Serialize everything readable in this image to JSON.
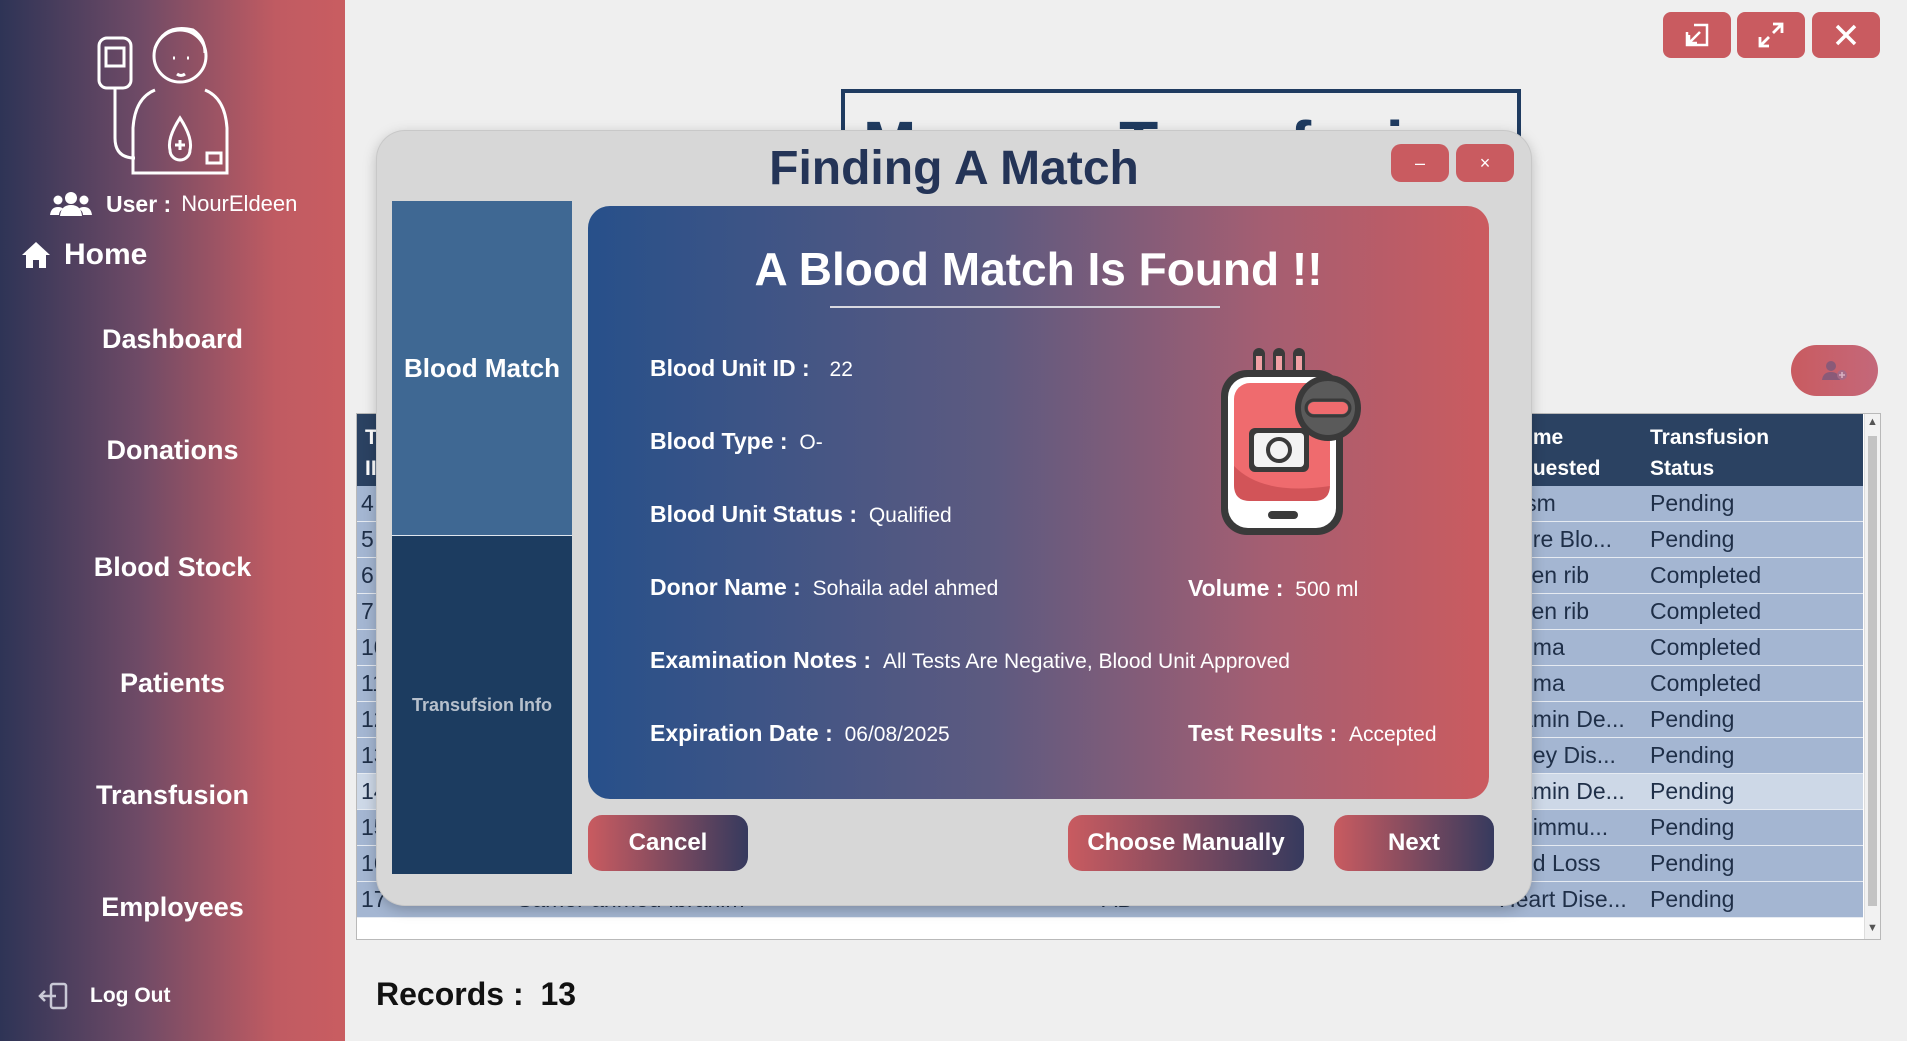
{
  "sidebar": {
    "user_label": "User :",
    "user_name": "NourEldeen",
    "home_label": "Home",
    "nav": [
      "Dashboard",
      "Donations",
      "Blood Stock",
      "Patients",
      "Transfusion",
      "Employees"
    ],
    "logout_label": "Log Out"
  },
  "page": {
    "title_partial": "Manage Transfusion",
    "records_label": "Records :",
    "records_count": "13"
  },
  "table": {
    "headers": {
      "id": "T\nII",
      "volume": "ume\nquested",
      "status": "Transfusion\nStatus"
    },
    "rows": [
      {
        "id": "4",
        "reason": "ism",
        "status": "Pending"
      },
      {
        "id": "5",
        "reason": "ere Blo...",
        "status": "Pending"
      },
      {
        "id": "6",
        "reason": "ken rib",
        "status": "Completed"
      },
      {
        "id": "7",
        "reason": "ken rib",
        "status": "Completed"
      },
      {
        "id": "10",
        "reason": "hma",
        "status": "Completed"
      },
      {
        "id": "11",
        "reason": "hma",
        "status": "Completed"
      },
      {
        "id": "12",
        "reason": "amin De...",
        "status": "Pending"
      },
      {
        "id": "13",
        "reason": "ney Dis...",
        "status": "Pending"
      },
      {
        "id": "14",
        "reason": "amin De...",
        "status": "Pending"
      },
      {
        "id": "15",
        "reason": "oimmu...",
        "status": "Pending"
      },
      {
        "id": "16",
        "reason": "od Loss",
        "status": "Pending"
      },
      {
        "id": "17",
        "reason": "Heart Dise...",
        "status": "Pending",
        "patient": "Samer ahmed  Ibrahim",
        "blood": "AB"
      }
    ]
  },
  "dialog": {
    "title": "Finding A Match",
    "minimize": "–",
    "close": "×",
    "tabs": [
      "Blood Match",
      "Transufsion Info"
    ],
    "headline": "A Blood Match Is Found !!",
    "fields": {
      "unit_id_label": "Blood Unit ID :",
      "unit_id": "22",
      "type_label": "Blood Type :",
      "type": "O-",
      "status_label": "Blood Unit Status :",
      "status": "Qualified",
      "donor_label": "Donor Name :",
      "donor": "Sohaila adel  ahmed",
      "volume_label": "Volume :",
      "volume": "500 ml",
      "notes_label": "Examination Notes :",
      "notes": "All Tests Are Negative, Blood Unit Approved",
      "expiry_label": "Expiration Date :",
      "expiry": "06/08/2025",
      "tests_label": "Test Results :",
      "tests": "Accepted"
    },
    "buttons": {
      "cancel": "Cancel",
      "manual": "Choose Manually",
      "next": "Next"
    }
  },
  "colors": {
    "accent": "#c95b60",
    "navy": "#2b4262",
    "row": "#a4b6d2"
  },
  "icons": [
    "blood-donor-avatar-icon",
    "users-icon",
    "home-icon",
    "logout-icon",
    "restore-window-icon",
    "maximize-icon",
    "close-icon",
    "add-user-icon",
    "blood-bag-minus-icon"
  ]
}
